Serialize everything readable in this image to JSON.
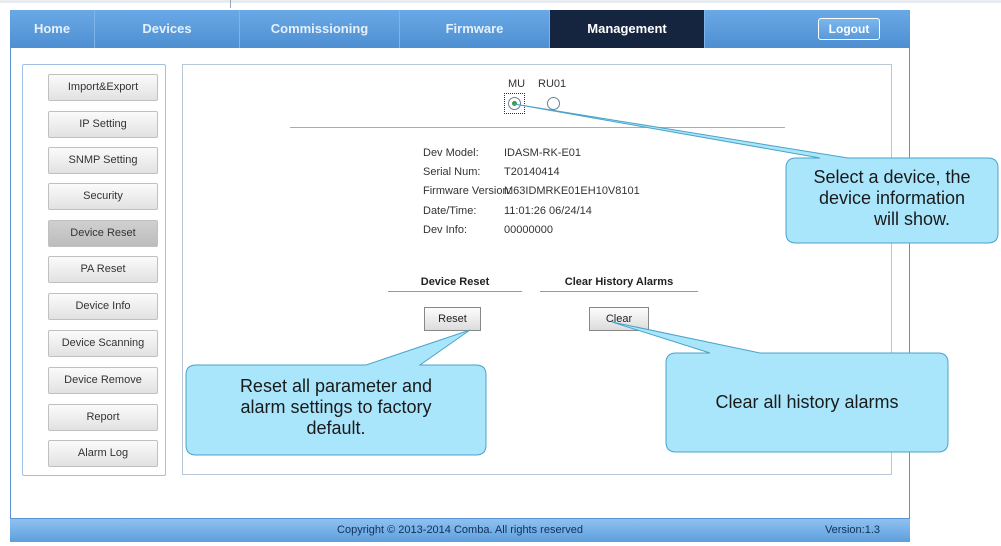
{
  "nav": {
    "items": [
      {
        "label": "Home"
      },
      {
        "label": "Devices"
      },
      {
        "label": "Commissioning"
      },
      {
        "label": "Firmware"
      },
      {
        "label": "Management"
      }
    ],
    "logout_label": "Logout",
    "active": "Management"
  },
  "sidebar": {
    "items": [
      {
        "label": "Import&Export"
      },
      {
        "label": "IP Setting"
      },
      {
        "label": "SNMP Setting"
      },
      {
        "label": "Security"
      },
      {
        "label": "Device Reset"
      },
      {
        "label": "PA Reset"
      },
      {
        "label": "Device Info"
      },
      {
        "label": "Device Scanning"
      },
      {
        "label": "Device Remove"
      },
      {
        "label": "Report"
      },
      {
        "label": "Alarm Log"
      }
    ],
    "active": "Device Reset"
  },
  "device_select": {
    "options": [
      {
        "label": "MU",
        "selected": true
      },
      {
        "label": "RU01",
        "selected": false
      }
    ]
  },
  "device_info": [
    {
      "key": "Dev Model:",
      "value": "IDASM-RK-E01"
    },
    {
      "key": "Serial Num:",
      "value": "T20140414"
    },
    {
      "key": "Firmware Version:",
      "value": "M63IDMRKE01EH10V8101"
    },
    {
      "key": "Date/Time:",
      "value": "11:01:26 06/24/14"
    },
    {
      "key": "Dev Info:",
      "value": "00000000"
    }
  ],
  "sections": {
    "reset": {
      "title": "Device Reset",
      "button": "Reset"
    },
    "clear": {
      "title": "Clear History Alarms",
      "button": "Clear"
    }
  },
  "callouts": {
    "select": [
      "Select a device, the",
      "device information",
      "will show."
    ],
    "reset": [
      "Reset all parameter and",
      "alarm settings to factory",
      "default."
    ],
    "clear": [
      "Clear all history alarms"
    ]
  },
  "footer": {
    "copyright": "Copyright © 2013-2014 Comba. All rights reserved",
    "version": "Version:1.3"
  },
  "colors": {
    "nav_bg": "#5a9ada",
    "nav_active": "#16253f",
    "callout_fill": "#a9e6fb",
    "callout_stroke": "#4aa3c9"
  }
}
